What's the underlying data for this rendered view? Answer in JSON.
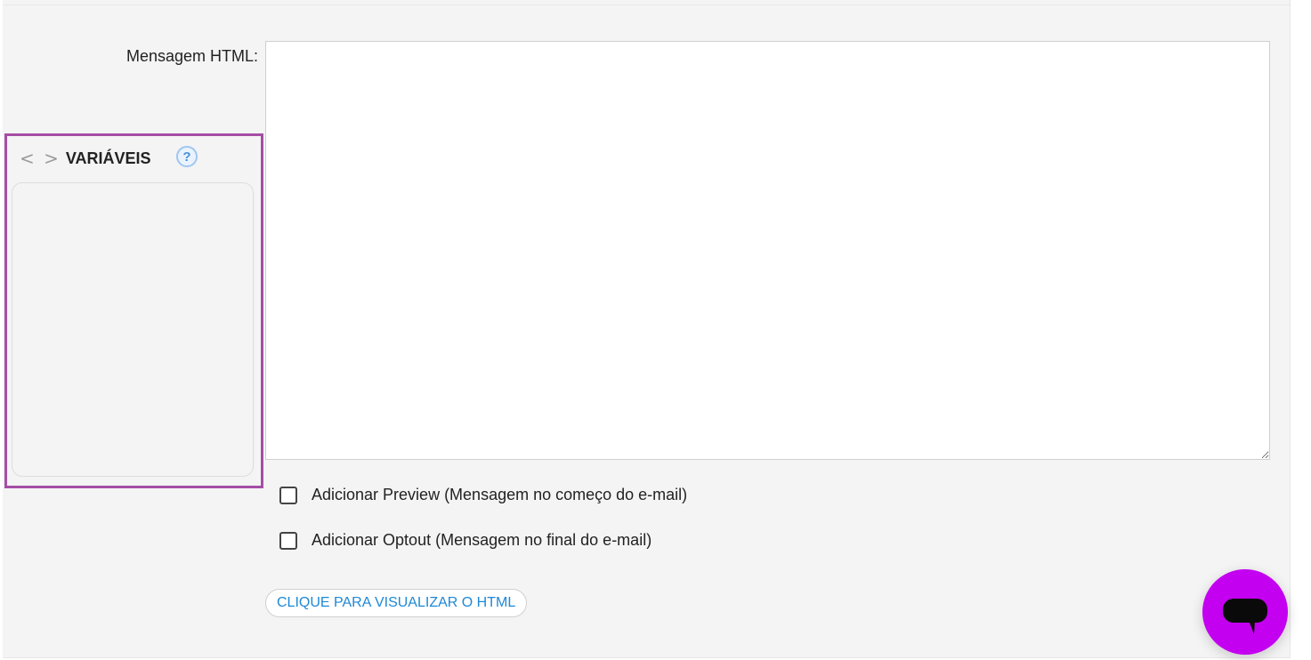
{
  "form": {
    "html_label": "Mensagem HTML:",
    "html_value": ""
  },
  "variables": {
    "code_icon": "code-icon",
    "code_glyph": "< >",
    "title": "VARIÁVEIS",
    "help_icon": "help-icon",
    "help_glyph": "?"
  },
  "options": {
    "preview_label": "Adicionar Preview (Mensagem no começo do e-mail)",
    "preview_checked": false,
    "optout_label": "Adicionar Optout (Mensagem no final do e-mail)",
    "optout_checked": false
  },
  "actions": {
    "view_html_label": "CLIQUE PARA VISUALIZAR O HTML"
  },
  "chat": {
    "icon": "chat-bubble-icon"
  },
  "colors": {
    "panel_bg": "#f4f4f4",
    "highlight_border": "#a54ea5",
    "link_blue": "#1e88d6",
    "chat_purple": "#c400f0"
  }
}
